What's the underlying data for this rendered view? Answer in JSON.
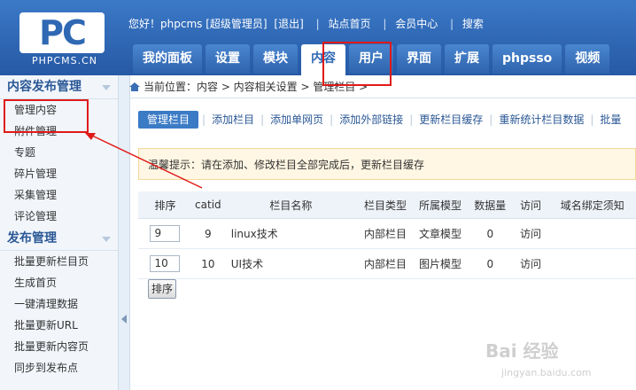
{
  "header": {
    "logo_text": "PC",
    "logo_sub": "PHPCMS.CN",
    "greeting": "您好！phpcms [超级管理员]",
    "logout": "[退出]",
    "links": [
      "站点首页",
      "会员中心",
      "搜索"
    ]
  },
  "nav": {
    "tabs": [
      "我的面板",
      "设置",
      "模块",
      "内容",
      "用户",
      "界面",
      "扩展",
      "phpsso",
      "视频"
    ],
    "active_index": 3
  },
  "sidebar": {
    "section1_title": "内容发布管理",
    "section1_items": [
      "管理内容",
      "附件管理",
      "专题",
      "碎片管理",
      "采集管理",
      "评论管理"
    ],
    "section2_title": "发布管理",
    "section2_items": [
      "批量更新栏目页",
      "生成首页",
      "一键清理数据",
      "批量更新URL",
      "批量更新内容页",
      "同步到发布点"
    ]
  },
  "breadcrumb": "当前位置：内容 > 内容相关设置 > 管理栏目 >",
  "subtabs": [
    "管理栏目",
    "添加栏目",
    "添加单网页",
    "添加外部链接",
    "更新栏目缓存",
    "重新统计栏目数据",
    "批量"
  ],
  "tip": "温馨提示：请在添加、修改栏目全部完成后，更新栏目缓存",
  "table": {
    "headers": [
      "排序",
      "catid",
      "栏目名称",
      "栏目类型",
      "所属模型",
      "数据量",
      "访问",
      "域名绑定须知"
    ],
    "rows": [
      {
        "order": "9",
        "catid": "9",
        "name": "linux技术",
        "type": "内部栏目",
        "model": "文章模型",
        "count": "0",
        "visit": "访问"
      },
      {
        "order": "10",
        "catid": "10",
        "name": "UI技术",
        "type": "内部栏目",
        "model": "图片模型",
        "count": "0",
        "visit": "访问"
      }
    ],
    "sort_button": "排序"
  },
  "watermark": {
    "main": "Bai 经验",
    "sub": "jingyan.baidu.com"
  },
  "colors": {
    "header_blue": "#2f68b3",
    "annotation_red": "#e01a1a",
    "tip_bg": "#fff7e3"
  }
}
